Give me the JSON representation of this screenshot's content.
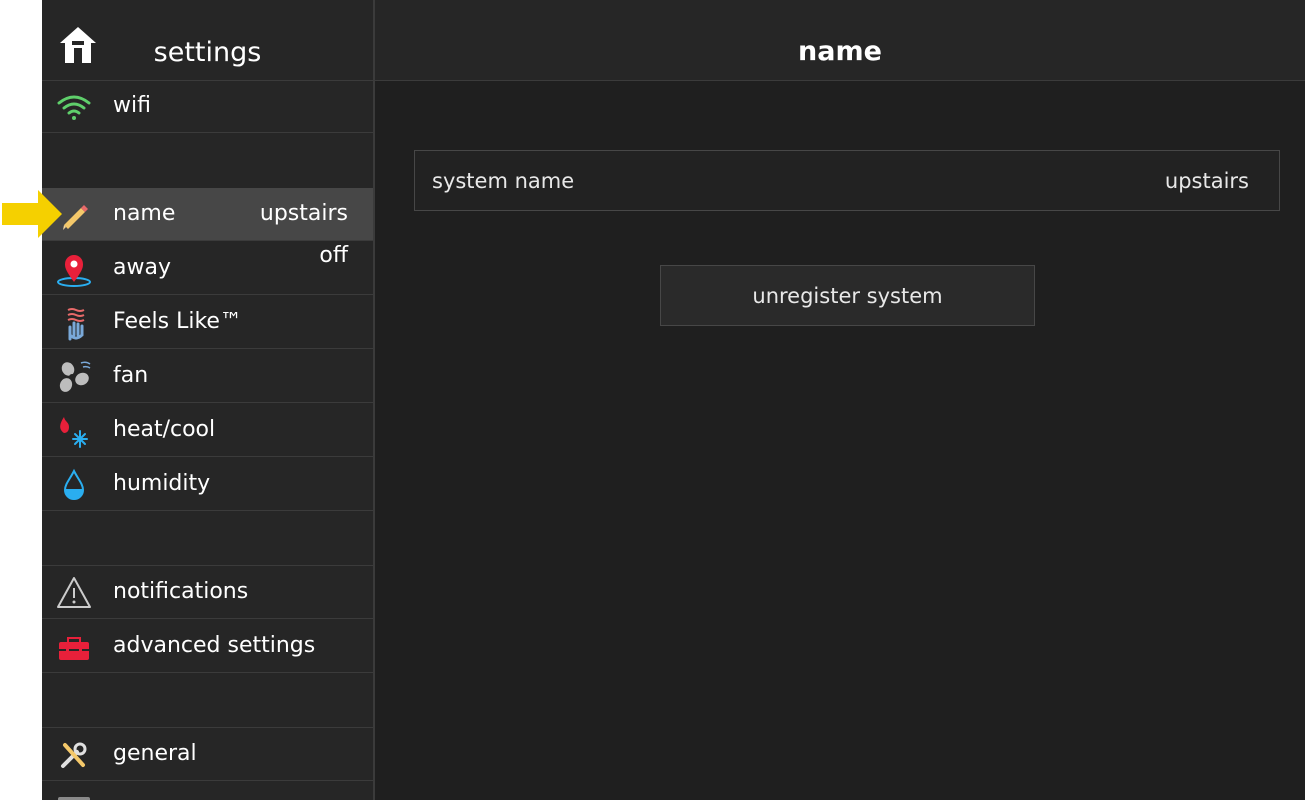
{
  "sidebar": {
    "title": "settings",
    "items": [
      {
        "label": "wifi",
        "value": "",
        "icon": "wifi-icon"
      },
      {
        "label": "name",
        "value": "upstairs",
        "icon": "pencil-icon"
      },
      {
        "label": "away",
        "value": "off",
        "icon": "location-pin-icon"
      },
      {
        "label": "Feels Like™",
        "value": "",
        "icon": "feels-like-icon"
      },
      {
        "label": "fan",
        "value": "",
        "icon": "fan-icon"
      },
      {
        "label": "heat/cool",
        "value": "",
        "icon": "heat-cool-icon"
      },
      {
        "label": "humidity",
        "value": "",
        "icon": "water-drop-icon"
      },
      {
        "label": "notifications",
        "value": "",
        "icon": "warning-icon"
      },
      {
        "label": "advanced settings",
        "value": "",
        "icon": "toolbox-icon"
      },
      {
        "label": "general",
        "value": "",
        "icon": "tools-icon"
      }
    ]
  },
  "main": {
    "title": "name",
    "system_name_label": "system name",
    "system_name_value": "upstairs",
    "unregister_label": "unregister system"
  },
  "colors": {
    "background": "#1f1f1f",
    "sidebar": "#262626",
    "selected": "#474747",
    "wifi": "#5fcf6b",
    "pin": "#e8203a",
    "drop": "#2aaef0",
    "pointer_arrow": "#f5d000"
  }
}
